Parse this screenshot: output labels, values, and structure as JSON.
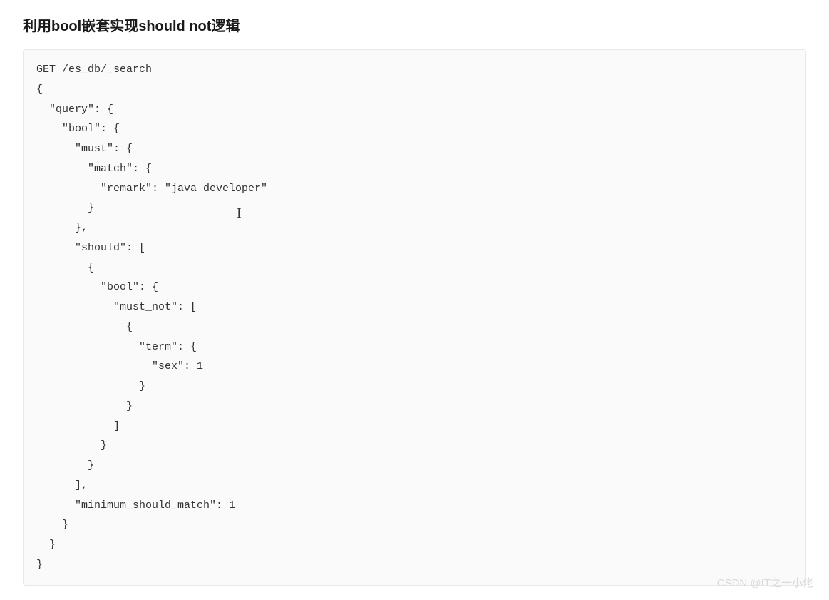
{
  "heading": "利用bool嵌套实现should not逻辑",
  "code": "GET /es_db/_search\n{\n  \"query\": {\n    \"bool\": {\n      \"must\": {\n        \"match\": {\n          \"remark\": \"java developer\"\n        }\n      },\n      \"should\": [\n        {\n          \"bool\": {\n            \"must_not\": [\n              {\n                \"term\": {\n                  \"sex\": 1\n                }\n              }\n            ]\n          }\n        }\n      ],\n      \"minimum_should_match\": 1\n    }\n  }\n}",
  "watermark": "CSDN @IT之一小佬"
}
